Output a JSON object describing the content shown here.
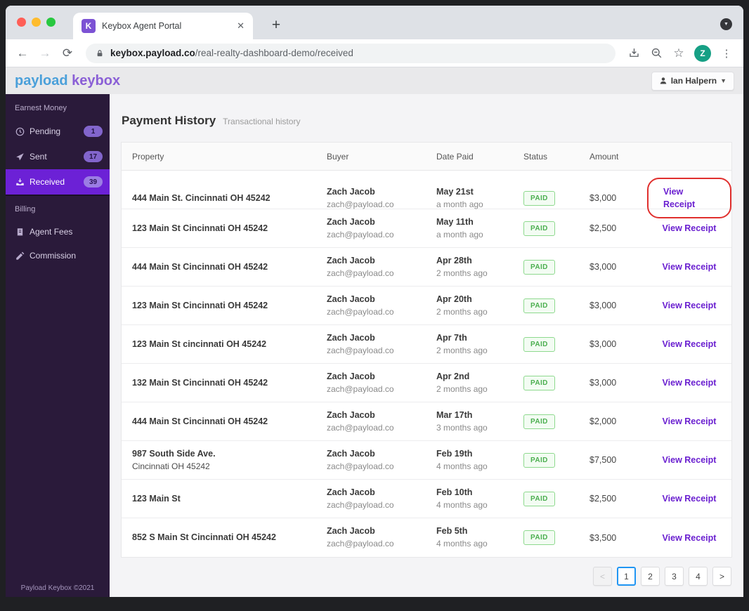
{
  "browser": {
    "tab": {
      "title": "Keybox Agent Portal",
      "favicon_letter": "K",
      "close_glyph": "✕",
      "new_tab_glyph": "+"
    },
    "url": {
      "domain": "keybox.payload.co",
      "path": "/real-realty-dashboard-demo/received"
    },
    "avatar_letter": "Z"
  },
  "header": {
    "brand_payload": "payload",
    "brand_keybox": "keybox",
    "user_name": "Ian Halpern"
  },
  "sidebar": {
    "sections": [
      {
        "label": "Earnest Money",
        "items": [
          {
            "label": "Pending",
            "icon": "clock-icon",
            "badge": "1",
            "active": false
          },
          {
            "label": "Sent",
            "icon": "send-icon",
            "badge": "17",
            "active": false
          },
          {
            "label": "Received",
            "icon": "inbox-download-icon",
            "badge": "39",
            "active": true
          }
        ]
      },
      {
        "label": "Billing",
        "items": [
          {
            "label": "Agent Fees",
            "icon": "invoice-icon",
            "badge": null,
            "active": false
          },
          {
            "label": "Commission",
            "icon": "commission-icon",
            "badge": null,
            "active": false
          }
        ]
      }
    ],
    "footer": "Payload Keybox ©2021"
  },
  "main": {
    "title": "Payment History",
    "subtitle": "Transactional history",
    "table": {
      "columns": [
        "Property",
        "Buyer",
        "Date Paid",
        "Status",
        "Amount",
        ""
      ],
      "rows": [
        {
          "property": "444 Main St. Cincinnati OH 45242",
          "property2": "",
          "buyer": "Zach Jacob",
          "email": "zach@payload.co",
          "date": "May 21st",
          "date_rel": "a month ago",
          "status": "PAID",
          "amount": "$3,000",
          "action": "View Receipt",
          "highlighted": true
        },
        {
          "property": "123 Main St Cincinnati OH 45242",
          "property2": "",
          "buyer": "Zach Jacob",
          "email": "zach@payload.co",
          "date": "May 11th",
          "date_rel": "a month ago",
          "status": "PAID",
          "amount": "$2,500",
          "action": "View Receipt",
          "highlighted": false
        },
        {
          "property": "444 Main St Cincinnati OH 45242",
          "property2": "",
          "buyer": "Zach Jacob",
          "email": "zach@payload.co",
          "date": "Apr 28th",
          "date_rel": "2 months ago",
          "status": "PAID",
          "amount": "$3,000",
          "action": "View Receipt",
          "highlighted": false
        },
        {
          "property": "123 Main St Cincinnati OH 45242",
          "property2": "",
          "buyer": "Zach Jacob",
          "email": "zach@payload.co",
          "date": "Apr 20th",
          "date_rel": "2 months ago",
          "status": "PAID",
          "amount": "$3,000",
          "action": "View Receipt",
          "highlighted": false
        },
        {
          "property": "123 Main St cincinnati OH 45242",
          "property2": "",
          "buyer": "Zach Jacob",
          "email": "zach@payload.co",
          "date": "Apr 7th",
          "date_rel": "2 months ago",
          "status": "PAID",
          "amount": "$3,000",
          "action": "View Receipt",
          "highlighted": false
        },
        {
          "property": "132 Main St Cincinnati OH 45242",
          "property2": "",
          "buyer": "Zach Jacob",
          "email": "zach@payload.co",
          "date": "Apr 2nd",
          "date_rel": "2 months ago",
          "status": "PAID",
          "amount": "$3,000",
          "action": "View Receipt",
          "highlighted": false
        },
        {
          "property": "444 Main St Cincinnati OH 45242",
          "property2": "",
          "buyer": "Zach Jacob",
          "email": "zach@payload.co",
          "date": "Mar 17th",
          "date_rel": "3 months ago",
          "status": "PAID",
          "amount": "$2,000",
          "action": "View Receipt",
          "highlighted": false
        },
        {
          "property": "987 South Side Ave.",
          "property2": "Cincinnati OH 45242",
          "buyer": "Zach Jacob",
          "email": "zach@payload.co",
          "date": "Feb 19th",
          "date_rel": "4 months ago",
          "status": "PAID",
          "amount": "$7,500",
          "action": "View Receipt",
          "highlighted": false
        },
        {
          "property": "123 Main St",
          "property2": "",
          "buyer": "Zach Jacob",
          "email": "zach@payload.co",
          "date": "Feb 10th",
          "date_rel": "4 months ago",
          "status": "PAID",
          "amount": "$2,500",
          "action": "View Receipt",
          "highlighted": false
        },
        {
          "property": "852 S Main St Cincinnati OH 45242",
          "property2": "",
          "buyer": "Zach Jacob",
          "email": "zach@payload.co",
          "date": "Feb 5th",
          "date_rel": "4 months ago",
          "status": "PAID",
          "amount": "$3,500",
          "action": "View Receipt",
          "highlighted": false
        }
      ]
    },
    "pagination": {
      "prev": "<",
      "pages": [
        "1",
        "2",
        "3",
        "4"
      ],
      "active_page": "1",
      "next": ">"
    }
  },
  "colors": {
    "accent_purple": "#6c21d6",
    "brand_blue": "#4ba0da",
    "brand_purple": "#8a5fd6",
    "paid_green": "#4caf50",
    "highlight_red": "#e0302e",
    "pagination_active_blue": "#2196f3",
    "sidebar_bg": "#2a1a3a",
    "avatar_green": "#16a085"
  }
}
